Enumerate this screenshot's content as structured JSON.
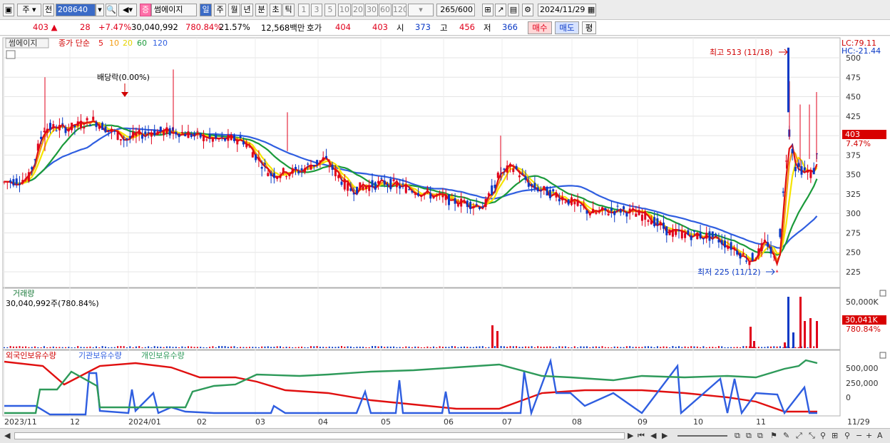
{
  "toolbar": {
    "market_label": "주",
    "prev_label": "전",
    "code": "208640",
    "stock_badge": "증",
    "stock_name": "썸에이지",
    "periods": [
      "일",
      "주",
      "월",
      "년",
      "분",
      "초",
      "틱"
    ],
    "minutes": [
      "1",
      "3",
      "5",
      "10",
      "20",
      "30",
      "60",
      "120"
    ],
    "count": "265",
    "count_max": "/600",
    "date": "2024/11/29"
  },
  "quote": {
    "price": "403 ▲",
    "change": "28",
    "change_pct": "+7.47%",
    "volume": "30,040,992",
    "volume_ratio": "780.84%",
    "turnover": "21.57%",
    "amount": "12,568백만",
    "bid_label": "호가",
    "bid": "404",
    "ask": "403",
    "open_label": "시",
    "open": "373",
    "high_label": "고",
    "high": "456",
    "low_label": "저",
    "low": "366",
    "buy_label": "매수",
    "sell_label": "매도",
    "eval_label": "평"
  },
  "price_panel": {
    "stock_tag": "썸에이지",
    "legend_prefix": "종가 단순",
    "ma_periods": [
      "5",
      "10",
      "20",
      "60",
      "120"
    ],
    "lc": "LC:79.11",
    "hc": "HC:-21.44",
    "high_note": "최고 513 (11/18)",
    "low_note": "최저 225 (11/12)",
    "dividend_note": "배당락(0.00%)",
    "current_price_tag": "403",
    "current_pct_tag": "7.47%",
    "y_ticks": [
      "500",
      "475",
      "450",
      "425",
      "400",
      "375",
      "350",
      "325",
      "300",
      "275",
      "250",
      "225"
    ]
  },
  "volume_panel": {
    "title": "거래량",
    "summary": "30,040,992주(780.84%)",
    "y_tick": "50,000K",
    "current_tag": "30,041K",
    "current_pct": "780.84%"
  },
  "holding_panel": {
    "legend": [
      "외국인보유수량",
      "기관보유수량",
      "개인보유수량"
    ],
    "y_ticks": [
      "500,000",
      "250,000",
      "0"
    ]
  },
  "x_axis": {
    "labels": [
      "2023/11",
      "12",
      "2024/01",
      "02",
      "03",
      "04",
      "05",
      "06",
      "07",
      "08",
      "09",
      "10",
      "11"
    ],
    "end_label": "11/29"
  },
  "colors": {
    "up": "#e0001b",
    "down": "#0a39c5",
    "ma5": "#e01010",
    "ma10": "#f39c12",
    "ma20": "#f5e400",
    "ma60": "#1a9a3a",
    "ma120": "#2f5ee0",
    "foreign": "#e01010",
    "institution": "#2f5ee0",
    "individual": "#2e9a5a"
  }
}
